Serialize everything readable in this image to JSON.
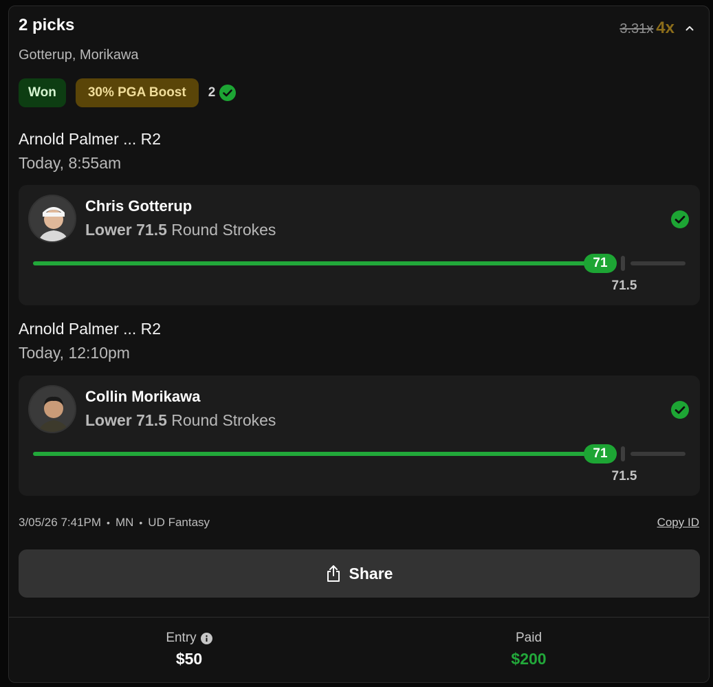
{
  "header": {
    "title": "2 picks",
    "multiplier_old": "3.31x",
    "multiplier_new": "4x",
    "subtitle": "Gotterup, Morikawa"
  },
  "badges": {
    "status": "Won",
    "boost": "30% PGA Boost",
    "correct_count": "2"
  },
  "picks": [
    {
      "event": "Arnold Palmer ... R2",
      "time": "Today, 8:55am",
      "player": "Chris Gotterup",
      "direction": "Lower",
      "line": "71.5",
      "stat": "Round Strokes",
      "result": "71",
      "line_label": "71.5"
    },
    {
      "event": "Arnold Palmer ... R2",
      "time": "Today, 12:10pm",
      "player": "Collin Morikawa",
      "direction": "Lower",
      "line": "71.5",
      "stat": "Round Strokes",
      "result": "71",
      "line_label": "71.5"
    }
  ],
  "meta": {
    "datetime": "3/05/26 7:41PM",
    "state": "MN",
    "platform": "UD Fantasy",
    "copy_id": "Copy ID"
  },
  "share": {
    "label": "Share"
  },
  "footer": {
    "entry_label": "Entry",
    "entry_value": "$50",
    "paid_label": "Paid",
    "paid_value": "$200"
  },
  "colors": {
    "win_green": "#1da534",
    "boost_gold": "#8c6d1a",
    "paid_green": "#22a83a"
  }
}
